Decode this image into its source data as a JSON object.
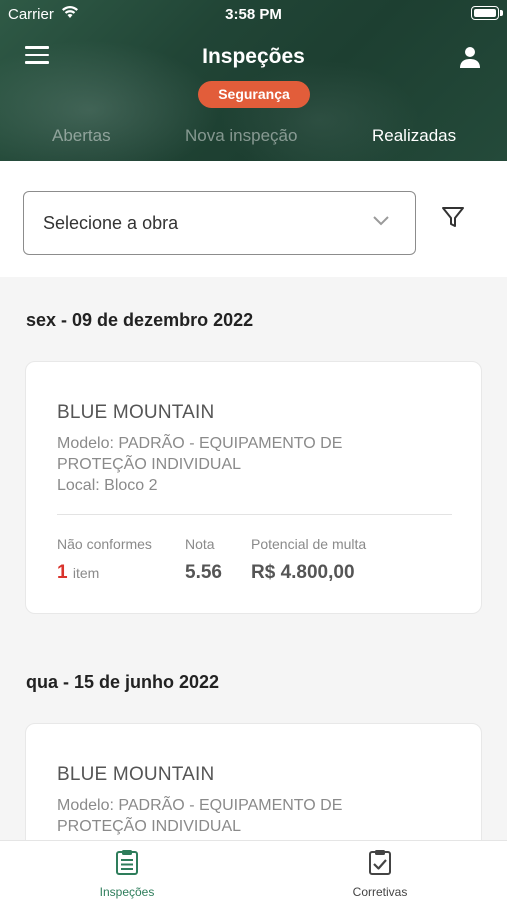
{
  "status_bar": {
    "carrier": "Carrier",
    "time": "3:58 PM"
  },
  "header": {
    "title": "Inspeções",
    "badge": "Segurança"
  },
  "tabs": [
    {
      "label": "Abertas",
      "active": false
    },
    {
      "label": "Nova inspeção",
      "active": false
    },
    {
      "label": "Realizadas",
      "active": true
    }
  ],
  "filter": {
    "select_value": "Selecione a obra"
  },
  "groups": [
    {
      "date": "sex - 09 de dezembro 2022",
      "card": {
        "name": "BLUE MOUNTAIN",
        "model_line1": "Modelo: PADRÃO - EQUIPAMENTO DE",
        "model_line2": "PROTEÇÃO INDIVIDUAL",
        "local": "Local: Bloco 2",
        "nc_label": "Não conformes",
        "nc_count": "1",
        "nc_unit": "item",
        "nota_label": "Nota",
        "nota_value": "5.56",
        "multa_label": "Potencial de multa",
        "multa_value": "R$ 4.800,00"
      }
    },
    {
      "date": "qua - 15 de junho 2022",
      "card": {
        "name": "BLUE MOUNTAIN",
        "model_line1": "Modelo: PADRÃO - EQUIPAMENTO DE",
        "model_line2": "PROTEÇÃO INDIVIDUAL"
      }
    }
  ],
  "bottom_nav": [
    {
      "label": "Inspeções",
      "icon": "clipboard-list-icon",
      "active": true
    },
    {
      "label": "Corretivas",
      "icon": "clipboard-check-icon",
      "active": false
    }
  ],
  "colors": {
    "brand_green": "#1f4434",
    "accent_orange": "#e25d3a",
    "active_nav": "#2e7d5b",
    "alert_red": "#d9332c"
  }
}
